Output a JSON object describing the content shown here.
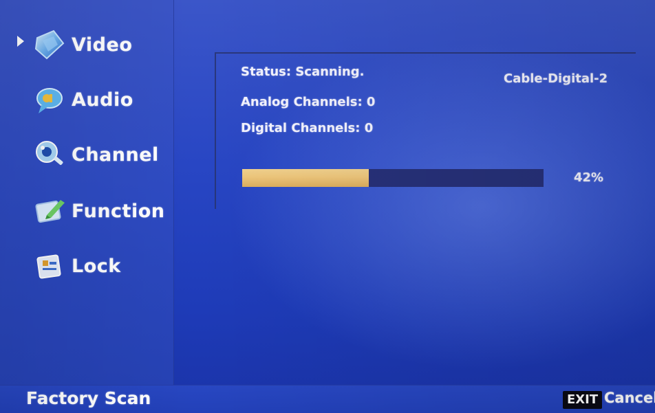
{
  "menu": {
    "items": [
      {
        "label": "Video",
        "icon": "video-icon",
        "selected": true
      },
      {
        "label": "Audio",
        "icon": "audio-icon",
        "selected": false
      },
      {
        "label": "Channel",
        "icon": "channel-icon",
        "selected": false
      },
      {
        "label": "Function",
        "icon": "function-icon",
        "selected": false
      },
      {
        "label": "Lock",
        "icon": "lock-icon",
        "selected": false
      }
    ]
  },
  "scan": {
    "status_text": "Status: Scanning.",
    "analog_text": "Analog Channels: 0",
    "digital_text": "Digital Channels: 0",
    "source": "Cable-Digital-2",
    "progress_fraction": 0.42,
    "progress_text": "42%"
  },
  "footer": {
    "title": "Factory Scan",
    "exit_key": "EXIT",
    "cancel_label": "Cancel"
  },
  "colors": {
    "background": "#2846c4",
    "progress_fill": "#eec67b",
    "progress_track": "#27317a"
  }
}
